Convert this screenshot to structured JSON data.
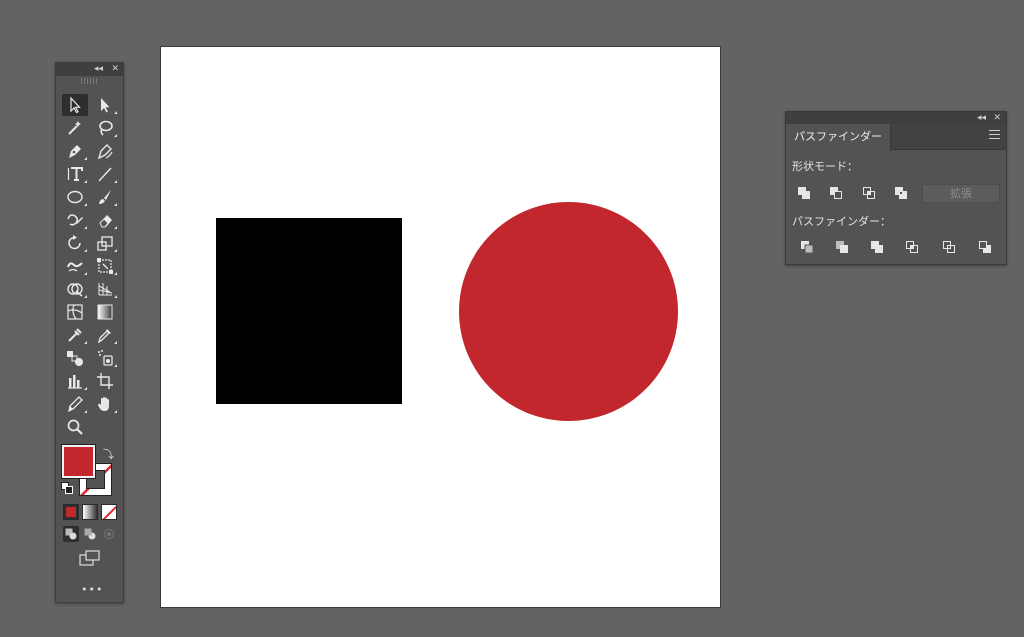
{
  "colors": {
    "fill": "#c1272d",
    "canvas": "#636363",
    "panel": "#535353"
  },
  "toolbar": {
    "icons": [
      "selection-tool-icon",
      "direct-selection-tool-icon",
      "magic-wand-tool-icon",
      "lasso-tool-icon",
      "pen-tool-icon",
      "curvature-tool-icon",
      "type-tool-icon",
      "line-segment-tool-icon",
      "ellipse-tool-icon",
      "paintbrush-tool-icon",
      "shaper-tool-icon",
      "eraser-tool-icon",
      "rotate-tool-icon",
      "scale-tool-icon",
      "warp-tool-icon",
      "free-transform-tool-icon",
      "shape-builder-tool-icon",
      "perspective-grid-tool-icon",
      "mesh-tool-icon",
      "gradient-tool-icon",
      "eyedropper-tool-icon",
      "eyedropper-alt-icon",
      "blend-tool-icon",
      "symbol-sprayer-tool-icon",
      "column-graph-tool-icon",
      "artboard-tool-icon",
      "slice-tool-icon",
      "hand-tool-icon",
      "zoom-tool-icon"
    ],
    "more": "•••"
  },
  "pathfinder": {
    "tab": "パスファインダー",
    "shape_modes_label": "形状モード：",
    "pathfinders_label": "パスファインダー：",
    "expand_label": "拡張"
  }
}
